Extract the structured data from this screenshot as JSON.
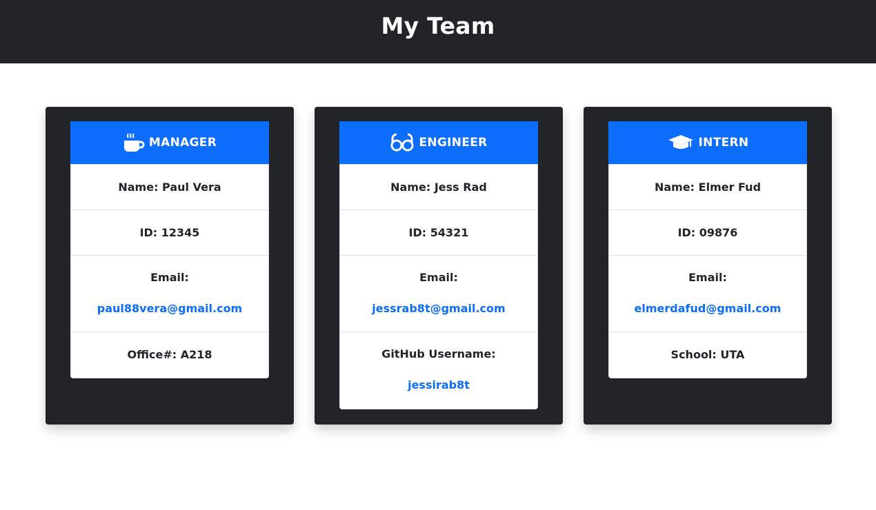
{
  "header": {
    "title": "My Team"
  },
  "cards": [
    {
      "role": "MANAGER",
      "icon": "mug-icon",
      "name": "Name: Paul Vera",
      "id": "ID: 12345",
      "email_label": "Email:",
      "email": "paul88vera@gmail.com",
      "extra": "Office#: A218"
    },
    {
      "role": "ENGINEER",
      "icon": "glasses-icon",
      "name": "Name: Jess Rad",
      "id": "ID: 54321",
      "email_label": "Email:",
      "email": "jessrab8t@gmail.com",
      "extra_label": "GitHub Username:",
      "github": "jessirab8t"
    },
    {
      "role": "INTERN",
      "icon": "graduation-cap-icon",
      "name": "Name: Elmer Fud",
      "id": "ID: 09876",
      "email_label": "Email:",
      "email": "elmerdafud@gmail.com",
      "extra": "School: UTA"
    }
  ],
  "colors": {
    "header_bg": "#212529",
    "accent": "#0d6efd",
    "link": "#0d6efd"
  }
}
